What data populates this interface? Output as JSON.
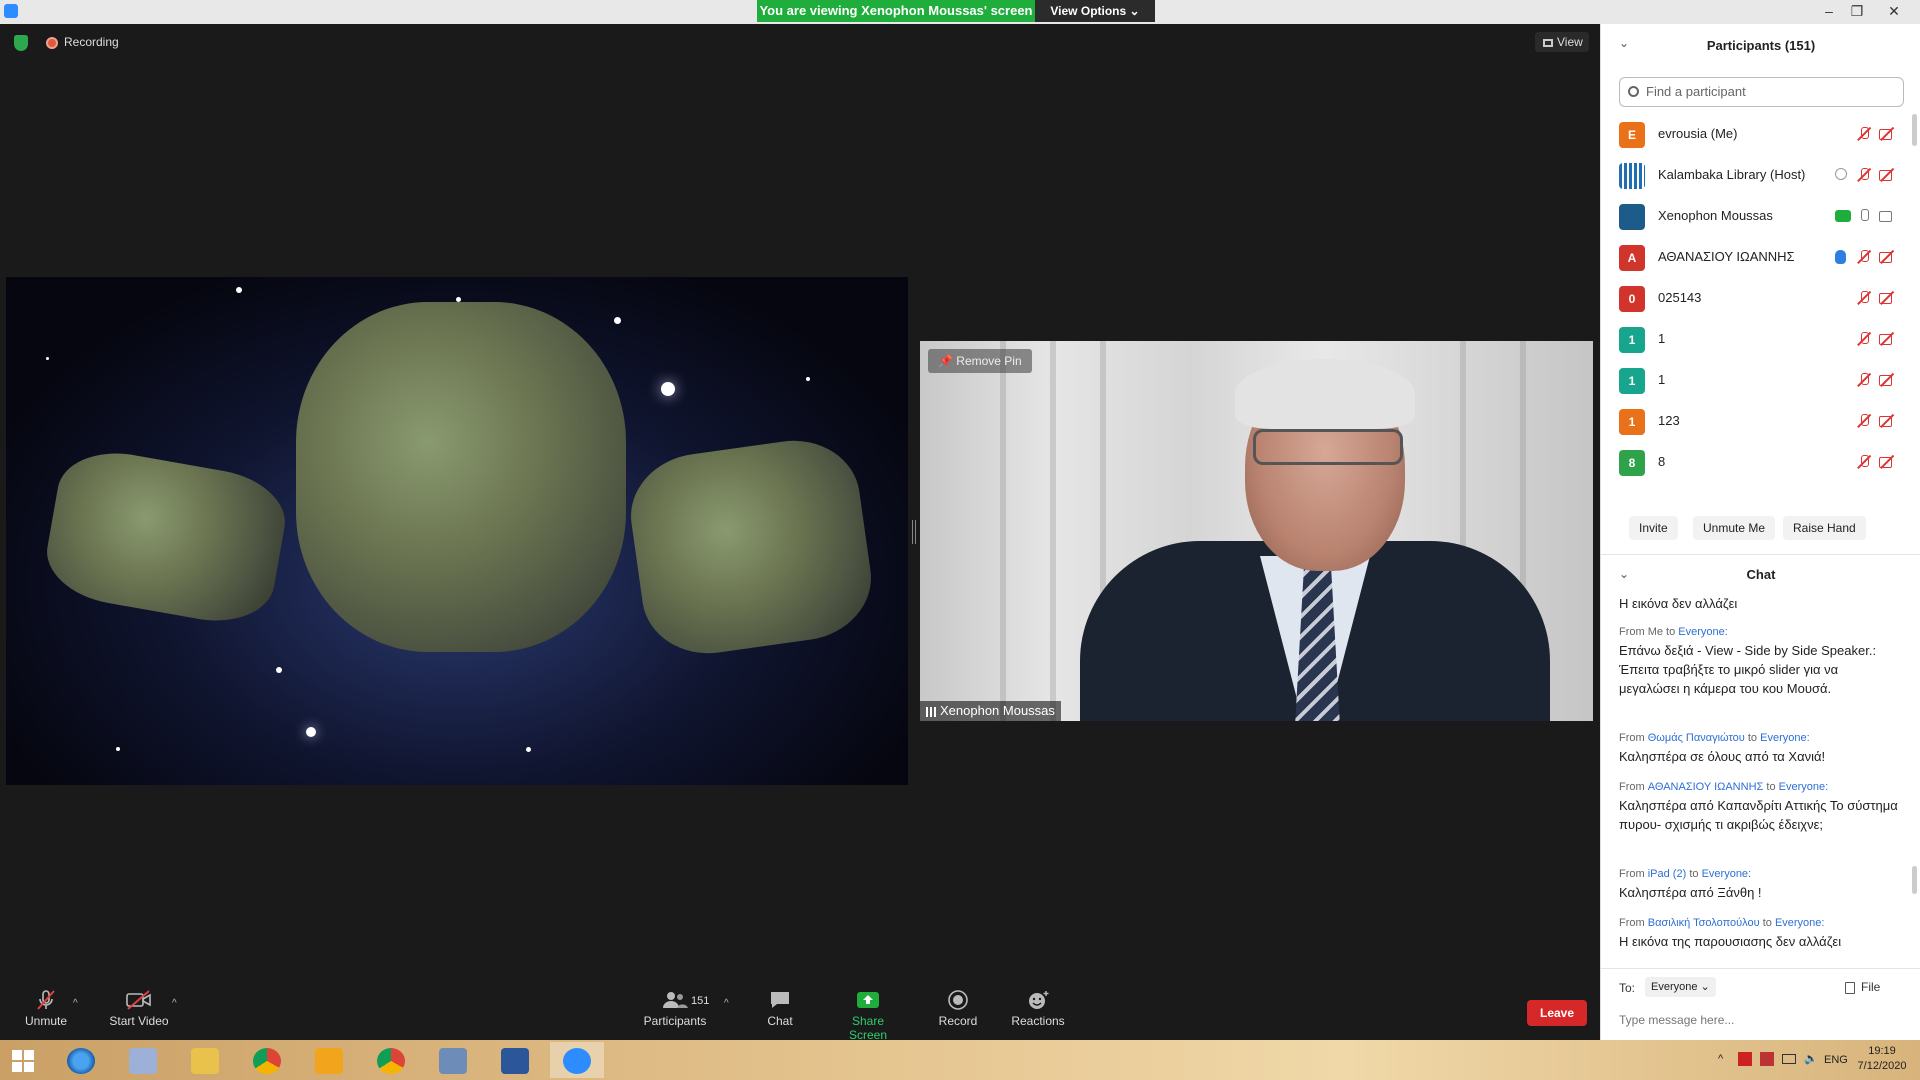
{
  "titlebar": {
    "viewing_banner": "You are viewing Xenophon Moussas' screen",
    "view_options": "View Options",
    "view_options_caret": "⌄",
    "minimize": "–",
    "restore": "❐",
    "close": "✕"
  },
  "stage": {
    "recording_label": "Recording",
    "view_label": "View",
    "remove_pin": "Remove Pin",
    "speaker_name": "Xenophon Moussas"
  },
  "toolbar": {
    "unmute": "Unmute",
    "start_video": "Start Video",
    "participants": "Participants",
    "participants_count": "151",
    "chat": "Chat",
    "share_screen": "Share Screen",
    "record": "Record",
    "reactions": "Reactions",
    "leave": "Leave",
    "caret": "^"
  },
  "participants_panel": {
    "title": "Participants (151)",
    "search_placeholder": "Find a participant",
    "items": [
      {
        "initial": "E",
        "name": "evrousia (Me)",
        "color": "#e8711a"
      },
      {
        "initial": "",
        "name": "Kalambaka Library (Host)",
        "color": "#1f6fb2"
      },
      {
        "initial": "",
        "name": "Xenophon Moussas",
        "color": "#1d5b8a"
      },
      {
        "initial": "A",
        "name": "ΑΘΑΝΑΣΙΟΥ ΙΩΑΝΝΗΣ",
        "color": "#d1342b"
      },
      {
        "initial": "0",
        "name": "025143",
        "color": "#d1342b"
      },
      {
        "initial": "1",
        "name": "1",
        "color": "#17a58d"
      },
      {
        "initial": "1",
        "name": "1",
        "color": "#17a58d"
      },
      {
        "initial": "1",
        "name": "123",
        "color": "#e8711a"
      },
      {
        "initial": "8",
        "name": "8",
        "color": "#2fa34a"
      }
    ],
    "invite": "Invite",
    "unmute_me": "Unmute Me",
    "raise_hand": "Raise Hand"
  },
  "chat": {
    "title": "Chat",
    "messages": [
      {
        "meta_from": "",
        "sender": "",
        "to": "",
        "recipient": "",
        "text": "Η εικόνα δεν αλλάζει"
      },
      {
        "meta_from": "From Me to",
        "sender": "",
        "to": "",
        "recipient": "Everyone:",
        "text": "Επάνω δεξιά - View - Side by Side Speaker.: Έπειτα τραβήξτε το μικρό slider για να μεγαλώσει η κάμερα του κου Μουσά."
      },
      {
        "meta_from": "From",
        "sender": "Θωμάς Παναγιώτου",
        "to": "to",
        "recipient": "Everyone:",
        "text": "Καλησπέρα σε όλους από τα Χανιά!"
      },
      {
        "meta_from": "From",
        "sender": "ΑΘΑΝΑΣΙΟΥ ΙΩΑΝΝΗΣ",
        "to": "to",
        "recipient": "Everyone:",
        "text": "Καλησπέρα από  Καπανδρίτι Αττικής Το  σύστημα πυρου- σχισμής τι ακριβώς  έδειχνε;"
      },
      {
        "meta_from": "From",
        "sender": "iPad (2)",
        "to": "to",
        "recipient": "Everyone:",
        "text": "Καλησπέρα από Ξάνθη !"
      },
      {
        "meta_from": "From",
        "sender": "Βασιλική Τσολοπούλου",
        "to": "to",
        "recipient": "Everyone:",
        "text": "Η εικόνα της παρουσιασης δεν αλλάζει"
      }
    ],
    "to_label": "To:",
    "to_value": "Everyone",
    "file_label": "File",
    "input_placeholder": "Type message here..."
  },
  "taskbar": {
    "lang": "ENG",
    "time": "19:19",
    "date": "7/12/2020"
  }
}
